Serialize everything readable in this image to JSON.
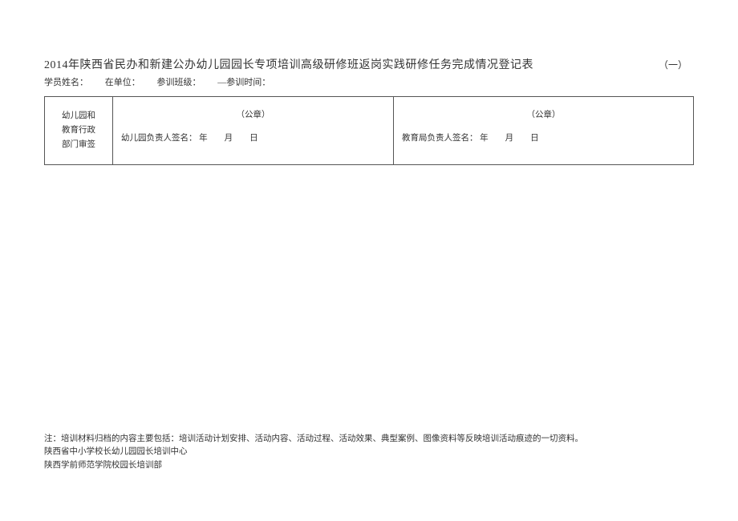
{
  "header": {
    "title": "2014年陕西省民办和新建公办幼儿园园长专项培训高级研修班返岗实践研修任务完成情况登记表",
    "page_number": "（一）"
  },
  "meta": {
    "name_label": "学员姓名：",
    "unit_label": "在单位：",
    "class_label": "参训班级：",
    "time_label": "—参训时间：",
    "name_value": "",
    "unit_value": "",
    "class_value": "",
    "time_value": ""
  },
  "table": {
    "row_header_line1": "幼儿园和",
    "row_header_line2": "教育行政",
    "row_header_line3": "部门审签",
    "seal_text": "（公章）",
    "left_sig_prefix": "幼儿园负责人签名：",
    "left_sig_date": "年　　月　　日",
    "right_sig_prefix": "教育局负责人签名：",
    "right_sig_date": "年　　月　　日"
  },
  "footer": {
    "note": "注：培训材料归档的内容主要包括：培训活动计划安排、活动内容、活动过程、活动效果、典型案例、图像资料等反映培训活动痕迹的一切资料。",
    "org1": "陕西省中小学校长幼儿园园长培训中心",
    "org2": "陕西学前师范学院校园长培训部"
  }
}
